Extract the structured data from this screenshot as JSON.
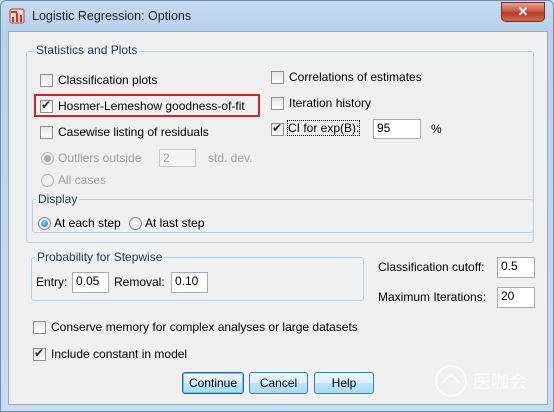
{
  "window": {
    "title": "Logistic Regression: Options",
    "close_label": "✕"
  },
  "statistics": {
    "legend": "Statistics and Plots",
    "classification_plots": "Classification plots",
    "hosmer": "Hosmer-Lemeshow goodness-of-fit",
    "casewise": "Casewise listing of residuals",
    "outliers_outside": "Outliers outside",
    "outliers_value": "2",
    "std_dev": "std. dev.",
    "all_cases": "All cases",
    "correlations": "Correlations of estimates",
    "iteration_history": "Iteration history",
    "ci_for_exp": "CI for exp(B):",
    "ci_value": "95",
    "percent": "%"
  },
  "display": {
    "legend": "Display",
    "at_each_step": "At each step",
    "at_last_step": "At last step"
  },
  "stepwise": {
    "legend": "Probability for Stepwise",
    "entry_label": "Entry:",
    "entry_value": "0.05",
    "removal_label": "Removal:",
    "removal_value": "0.10"
  },
  "classification": {
    "cutoff_label": "Classification cutoff:",
    "cutoff_value": "0.5",
    "max_iter_label": "Maximum Iterations:",
    "max_iter_value": "20"
  },
  "options": {
    "conserve_memory": "Conserve memory for complex analyses or large datasets",
    "include_constant": "Include constant in model"
  },
  "buttons": {
    "continue": "Continue",
    "cancel": "Cancel",
    "help": "Help"
  },
  "watermark": {
    "text": "医咖会"
  },
  "colors": {
    "highlight": "#d32020",
    "accent": "#1d6fb3"
  }
}
